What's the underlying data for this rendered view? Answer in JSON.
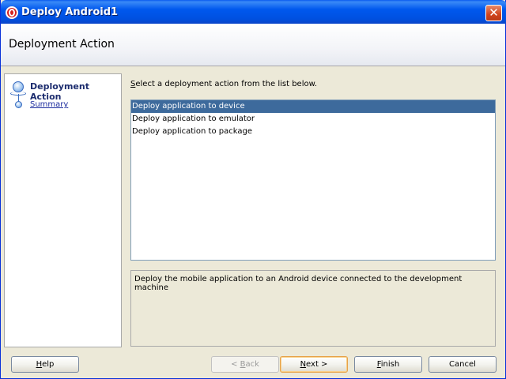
{
  "window": {
    "title": "Deploy Android1",
    "close_glyph": "✕"
  },
  "header": {
    "title": "Deployment Action"
  },
  "nav": {
    "steps": [
      {
        "label": "Deployment Action",
        "current": true
      },
      {
        "label": "Summary",
        "current": false
      }
    ]
  },
  "main": {
    "instruction_prefix": "S",
    "instruction_rest": "elect a deployment action from the list below.",
    "actions": [
      {
        "label": "Deploy application to device",
        "selected": true
      },
      {
        "label": "Deploy application to emulator",
        "selected": false
      },
      {
        "label": "Deploy application to package",
        "selected": false
      }
    ],
    "description": "Deploy the mobile application to an Android device connected to the development machine"
  },
  "buttons": {
    "help": {
      "mnemonic": "H",
      "rest": "elp"
    },
    "back": {
      "prefix": "< ",
      "mnemonic": "B",
      "rest": "ack"
    },
    "next": {
      "mnemonic": "N",
      "rest": "ext >"
    },
    "finish": {
      "mnemonic": "F",
      "rest": "inish"
    },
    "cancel": {
      "label": "Cancel"
    }
  },
  "colors": {
    "selection": "#3d6a9c",
    "titlebar": "#0058ee",
    "nav_link": "#1c2c9e"
  }
}
